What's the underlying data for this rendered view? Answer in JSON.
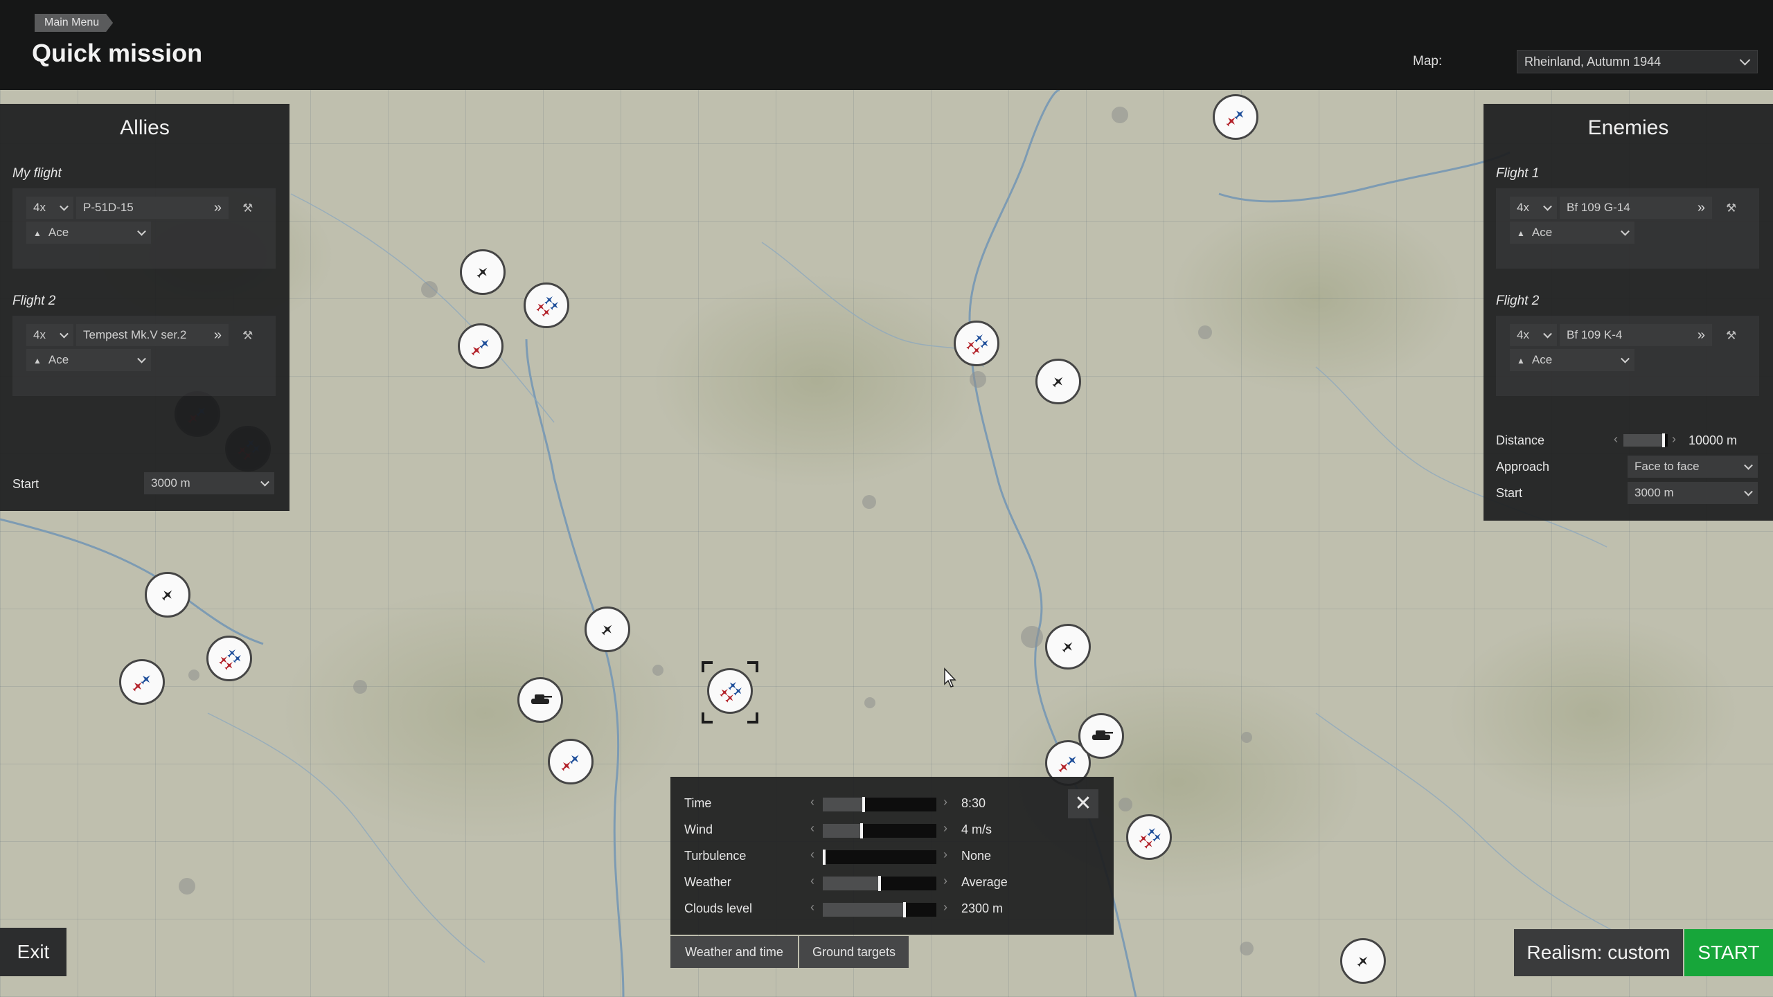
{
  "header": {
    "breadcrumb": "Main Menu",
    "title": "Quick mission",
    "map_label": "Map:",
    "map_value": "Rheinland, Autumn 1944"
  },
  "allies": {
    "title": "Allies",
    "flights": [
      {
        "label": "My flight",
        "count": "4x",
        "aircraft": "P-51D-15",
        "skill": "Ace"
      },
      {
        "label": "Flight 2",
        "count": "4x",
        "aircraft": "Tempest Mk.V ser.2",
        "skill": "Ace"
      }
    ],
    "start_label": "Start",
    "start_value": "3000 m"
  },
  "enemies": {
    "title": "Enemies",
    "flights": [
      {
        "label": "Flight 1",
        "count": "4x",
        "aircraft": "Bf 109 G-14",
        "skill": "Ace"
      },
      {
        "label": "Flight 2",
        "count": "4x",
        "aircraft": "Bf 109 K-4",
        "skill": "Ace"
      }
    ],
    "distance_label": "Distance",
    "distance_value": "10000 m",
    "distance_level": 0.9,
    "approach_label": "Approach",
    "approach_value": "Face to face",
    "start_label": "Start",
    "start_value": "3000 m"
  },
  "weather": {
    "rows": [
      {
        "label": "Time",
        "value": "8:30",
        "level": 0.36
      },
      {
        "label": "Wind",
        "value": "4 m/s",
        "level": 0.34
      },
      {
        "label": "Turbulence",
        "value": "None",
        "level": 0.0
      },
      {
        "label": "Weather",
        "value": "Average",
        "level": 0.5
      },
      {
        "label": "Clouds level",
        "value": "2300 m",
        "level": 0.72
      }
    ],
    "close_label": "✕"
  },
  "tabs": [
    "Weather and time",
    "Ground targets"
  ],
  "buttons": {
    "exit": "Exit",
    "realism": "Realism: custom",
    "start": "START"
  },
  "icons": {
    "dropdown": "chevron-down-icon",
    "aircraft_select": "double-chevron-right-icon",
    "loadout": "wrench-icon",
    "skill": "rank-up-icon",
    "close": "close-icon"
  },
  "colors": {
    "start_green": "#17a63a",
    "allied_blue": "#1f4f9a",
    "enemy_red": "#b3222a",
    "panel_bg": "#1c1d1e"
  }
}
